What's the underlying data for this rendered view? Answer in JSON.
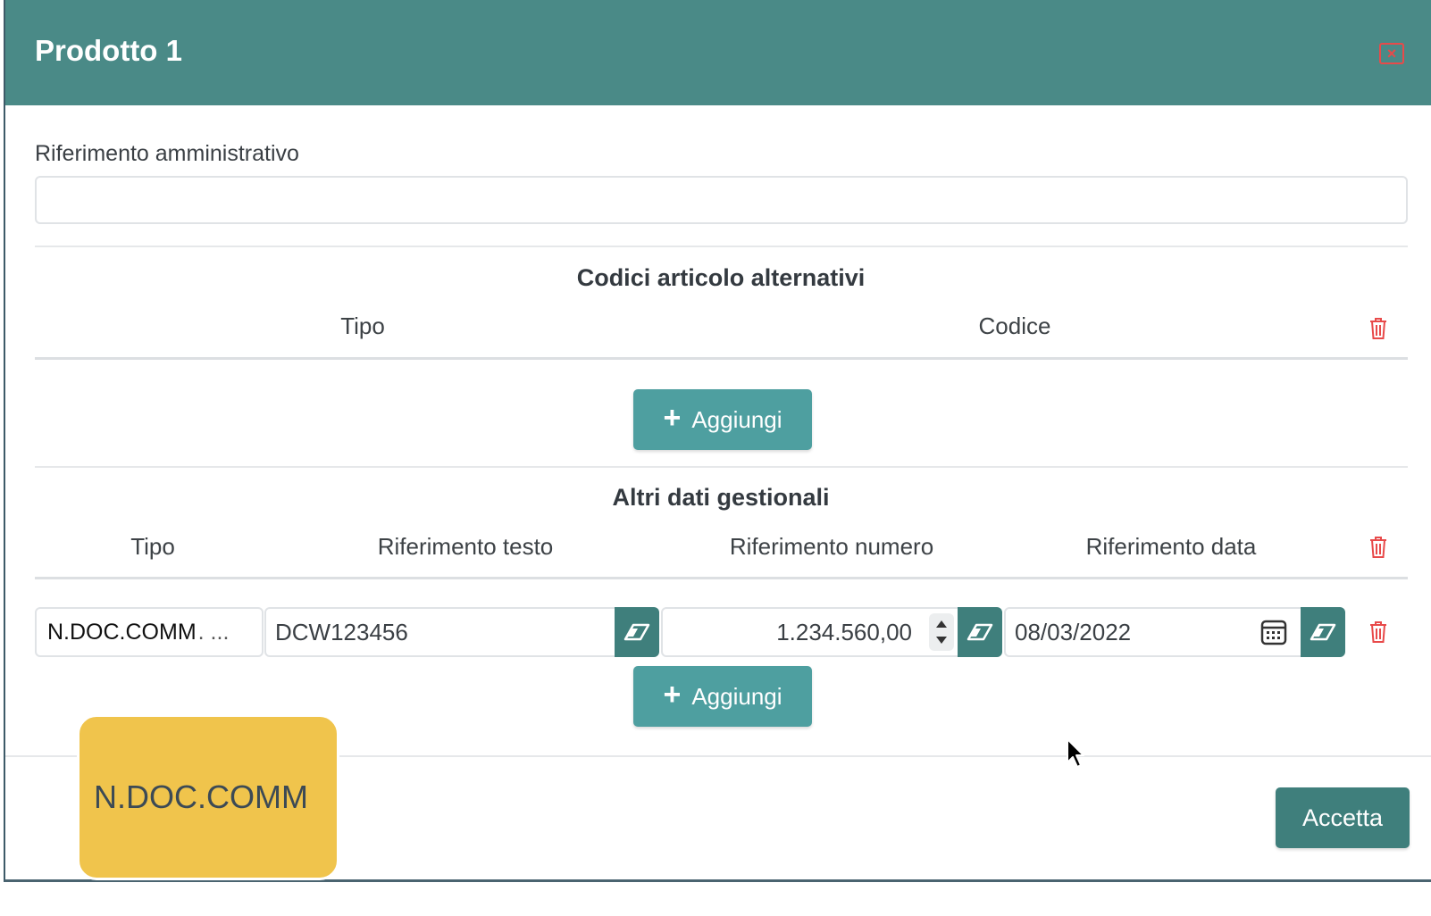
{
  "modal": {
    "title": "Prodotto 1",
    "close_icon": "close-x-icon"
  },
  "admin_reference": {
    "label": "Riferimento amministrativo",
    "value": ""
  },
  "alt_codes": {
    "title": "Codici articolo alternativi",
    "columns": [
      "Tipo",
      "Codice"
    ],
    "add_label": "Aggiungi"
  },
  "other_data": {
    "title": "Altri dati gestionali",
    "columns": [
      "Tipo",
      "Riferimento testo",
      "Riferimento numero",
      "Riferimento data"
    ],
    "row": {
      "tipo": "N.DOC.COMM",
      "tipo_ellipsis": ". ...",
      "testo": "DCW123456",
      "numero": "1.234.560,00",
      "data": "08/03/2022"
    },
    "add_label": "Aggiungi"
  },
  "footer": {
    "accept_label": "Accetta"
  },
  "tooltip": {
    "text": "N.DOC.COMM"
  },
  "colors": {
    "header": "#4a8a87",
    "button": "#4e9fa0",
    "button_dark": "#3f7f7c",
    "danger": "#e84a4a",
    "tooltip": "#f0c44c"
  }
}
